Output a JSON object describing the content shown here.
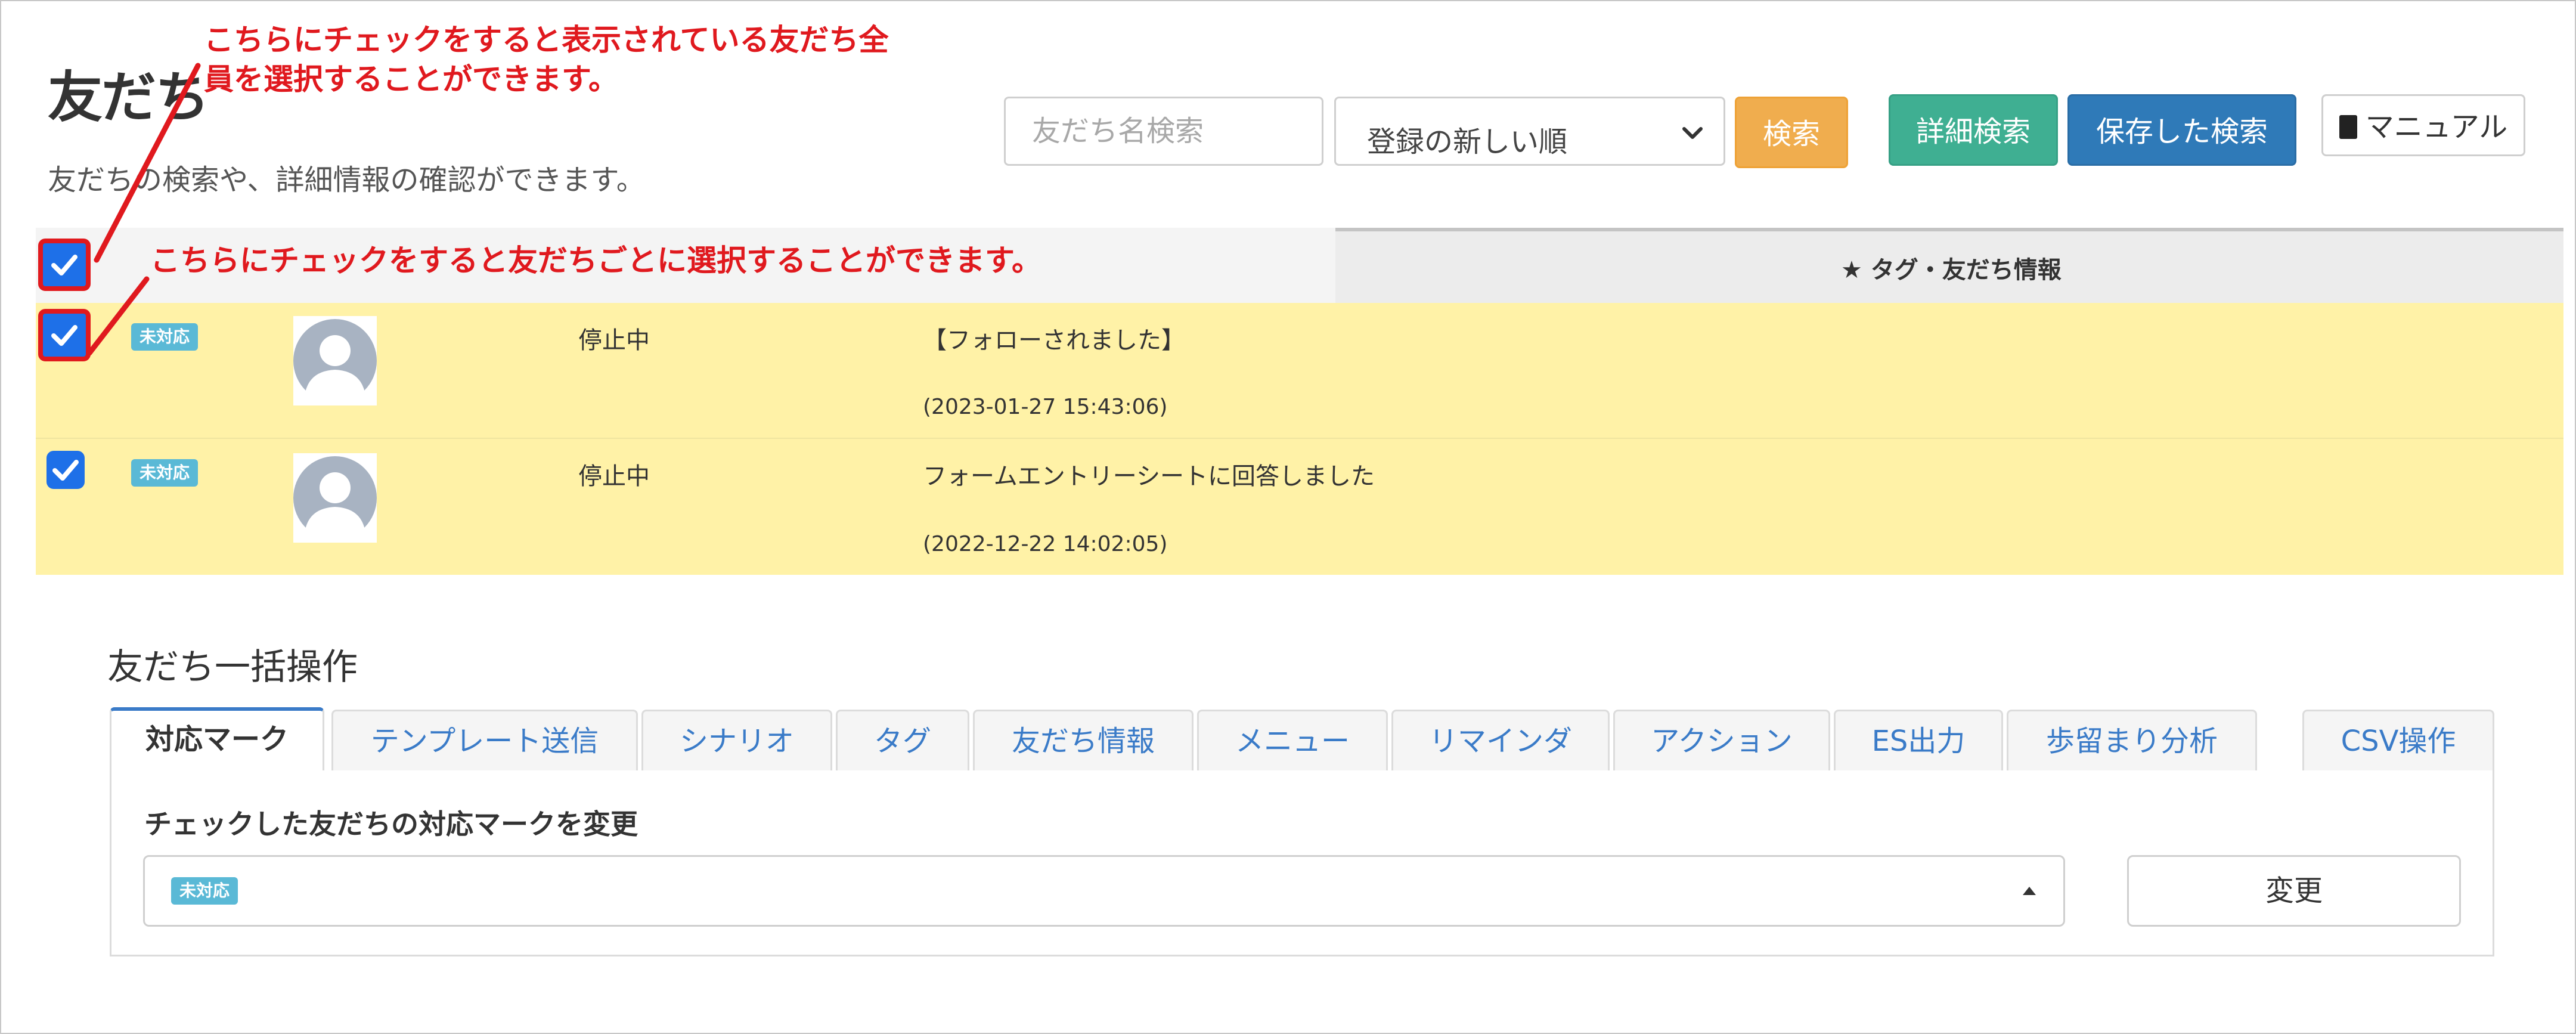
{
  "header": {
    "title": "友だち",
    "subtitle": "友だちの検索や、詳細情報の確認ができます。"
  },
  "search": {
    "placeholder": "友だち名検索",
    "sort_selected": "登録の新しい順",
    "search_label": "検索",
    "detail_label": "詳細検索",
    "saved_label": "保存した検索",
    "manual_label": "マニュアル"
  },
  "table": {
    "header_tag_label": "★ タグ・友だち情報",
    "rows": [
      {
        "badge": "未対応",
        "status": "停止中",
        "message": "【フォローされました】",
        "datetime": "(2023-01-27 15:43:06)",
        "checked": true
      },
      {
        "badge": "未対応",
        "status": "停止中",
        "message": "フォームエントリーシートに回答しました",
        "datetime": "(2022-12-22 14:02:05)",
        "checked": true
      }
    ]
  },
  "annotations": {
    "select_all_line1": "こちらにチェックをすると表示されている友だち全",
    "select_all_line2": "員を選択することができます。",
    "select_each": "こちらにチェックをすると友だちごとに選択することができます。",
    "color": "#e0191e"
  },
  "bulk": {
    "title": "友だち一括操作",
    "tabs": [
      "対応マーク",
      "テンプレート送信",
      "シナリオ",
      "タグ",
      "友だち情報",
      "メニュー",
      "リマインダ",
      "アクション",
      "ES出力",
      "歩留まり分析",
      "CSV操作"
    ],
    "active_tab": "対応マーク",
    "panel_label": "チェックした友だちの対応マークを変更",
    "selected_mark": "未対応",
    "change_label": "変更"
  },
  "colors": {
    "row_highlight": "#fff2a7",
    "badge": "#5ab9d6",
    "checkbox": "#1e70e8",
    "search_button": "#f0ad4e",
    "detail_button": "#3faf92",
    "saved_button": "#2f7ab8",
    "tab_text": "#3a7bc8"
  },
  "icons": {
    "manual": "book-icon",
    "sort": "chevron-down-icon",
    "checkbox": "checkmark-icon",
    "avatar": "user-silhouette-icon",
    "mark_select": "caret-up-icon"
  }
}
